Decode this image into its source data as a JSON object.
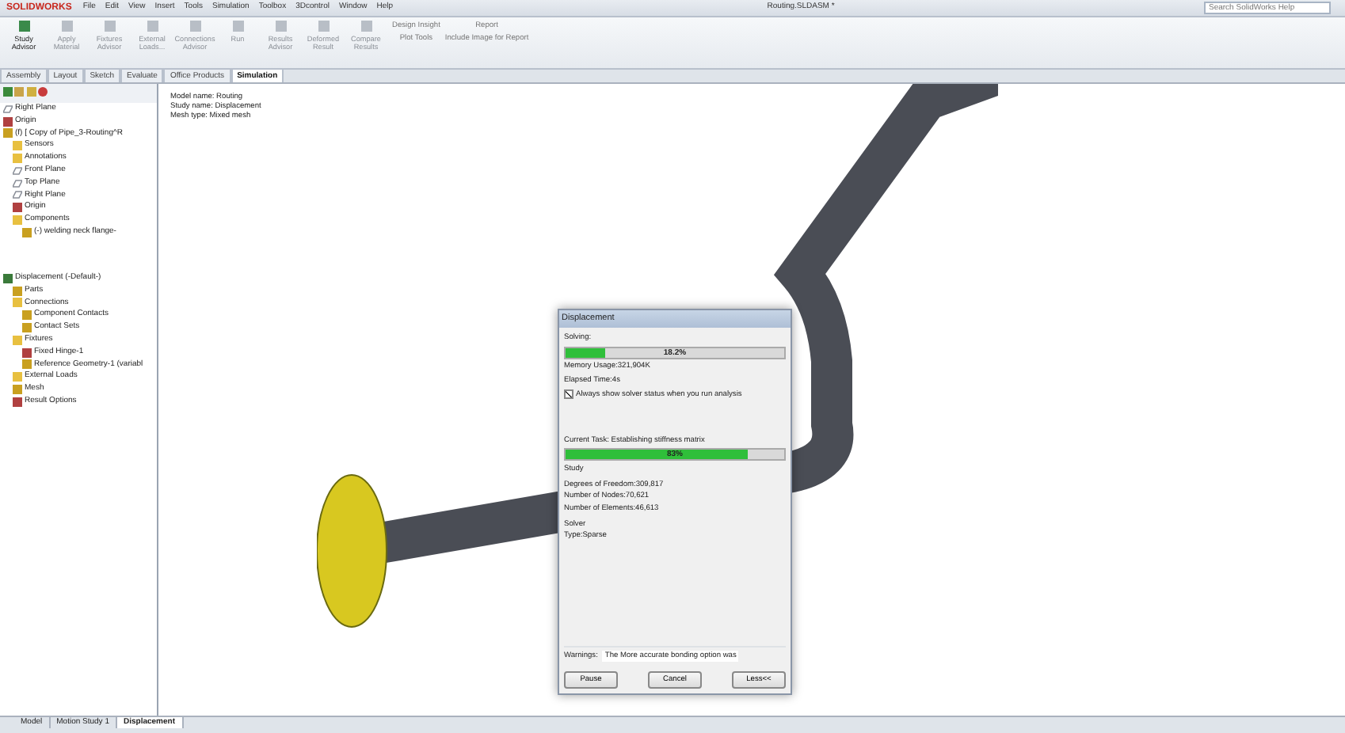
{
  "app": {
    "logo": "SOLIDWORKS",
    "menu": [
      "File",
      "Edit",
      "View",
      "Insert",
      "Tools",
      "Simulation",
      "Toolbox",
      "3Dcontrol",
      "Window",
      "Help"
    ],
    "title": "Routing.SLDASM *",
    "search": {
      "placeholder": "Search SolidWorks Help"
    }
  },
  "ribbon": {
    "tools": [
      {
        "label": "Study\nAdvisor",
        "disabled": false
      },
      {
        "label": "Apply\nMaterial",
        "disabled": true
      },
      {
        "label": "Fixtures\nAdvisor",
        "disabled": true
      },
      {
        "label": "External\nLoads...",
        "disabled": true
      },
      {
        "label": "Connections\nAdvisor",
        "disabled": true
      },
      {
        "label": "Run",
        "disabled": true
      },
      {
        "label": "Results\nAdvisor",
        "disabled": true
      },
      {
        "label": "Deformed\nResult",
        "disabled": true
      },
      {
        "label": "Compare\nResults",
        "disabled": true
      }
    ],
    "small_tools": [
      "Design Insight",
      "Plot Tools"
    ],
    "report_tools": [
      "Report",
      "Include Image for Report"
    ]
  },
  "command_tabs": [
    {
      "label": "Assembly",
      "selected": false
    },
    {
      "label": "Layout",
      "selected": false
    },
    {
      "label": "Sketch",
      "selected": false
    },
    {
      "label": "Evaluate",
      "selected": false
    },
    {
      "label": "Office Products",
      "selected": false
    },
    {
      "label": "Simulation",
      "selected": true
    }
  ],
  "feature_tree": [
    {
      "label": "Right Plane",
      "kind": "plane"
    },
    {
      "label": "Origin",
      "kind": "origin"
    },
    {
      "label": "(f) [ Copy of Pipe_3-Routing^R",
      "kind": "part",
      "children": [
        {
          "label": "Sensors",
          "kind": "folder"
        },
        {
          "label": "Annotations",
          "kind": "folder"
        },
        {
          "label": "Front Plane",
          "kind": "plane"
        },
        {
          "label": "Top Plane",
          "kind": "plane"
        },
        {
          "label": "Right Plane",
          "kind": "plane"
        },
        {
          "label": "Origin",
          "kind": "origin"
        },
        {
          "label": "Components",
          "kind": "folder",
          "children": [
            {
              "label": "(-) welding neck flange-",
              "kind": "part"
            }
          ]
        }
      ]
    }
  ],
  "simulation_tree": [
    {
      "label": "Displacement (-Default-)",
      "kind": "study",
      "children": [
        {
          "label": "Parts",
          "kind": "part"
        },
        {
          "label": "Connections",
          "kind": "folder",
          "children": [
            {
              "label": "Component Contacts",
              "kind": "part"
            },
            {
              "label": "Contact Sets",
              "kind": "part"
            }
          ]
        },
        {
          "label": "Fixtures",
          "kind": "folder",
          "children": [
            {
              "label": "Fixed Hinge-1",
              "kind": "origin"
            },
            {
              "label": "Reference Geometry-1 (variabl",
              "kind": "part"
            }
          ]
        },
        {
          "label": "External Loads",
          "kind": "folder"
        },
        {
          "label": "Mesh",
          "kind": "part"
        },
        {
          "label": "Result Options",
          "kind": "origin"
        }
      ]
    }
  ],
  "viewport_info": [
    "Model name: Routing",
    "Study name: Displacement",
    "Mesh type: Mixed mesh"
  ],
  "dialog": {
    "title": "Displacement",
    "solving_label": "Solving:",
    "solve_progress": {
      "level": 0.182,
      "text": "18.2%"
    },
    "memory": "Memory Usage:321,904K",
    "elapsed": "Elapsed Time:4s",
    "always_show": {
      "label": "Always show solver status when you run analysis",
      "checked": true
    },
    "current_task": "Current Task: Establishing stiffness matrix",
    "task_progress": {
      "level": 0.83,
      "text": "83%"
    },
    "study_label": "Study",
    "study_stats": [
      "Degrees of Freedom:309,817",
      "Number of Nodes:70,621",
      "Number of Elements:46,613"
    ],
    "solver_label": "Solver",
    "solver_type": "Type:Sparse",
    "warnings_label": "Warnings:",
    "warning_text": "The More accurate bonding option was",
    "buttons": [
      "Pause",
      "Cancel",
      "Less<<"
    ]
  },
  "bottom_tabs": [
    {
      "label": "Model",
      "selected": false
    },
    {
      "label": "Motion Study 1",
      "selected": false
    },
    {
      "label": "Displacement",
      "selected": true
    }
  ]
}
